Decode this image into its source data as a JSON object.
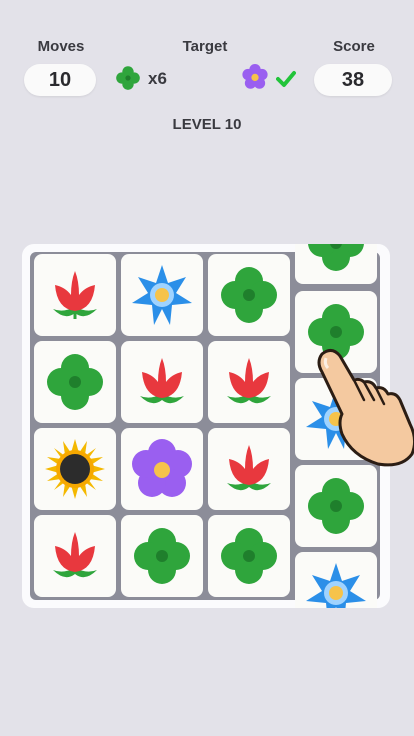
{
  "hud": {
    "moves_label": "Moves",
    "moves_value": "10",
    "target_label": "Target",
    "target_clover_count": "x6",
    "target_flower_done": true,
    "score_label": "Score",
    "score_value": "38"
  },
  "level_text": "LEVEL 10",
  "board": {
    "columns": [
      [
        "tulip",
        "clover",
        "sunflower",
        "tulip"
      ],
      [
        "blue-star",
        "tulip",
        "purple-flower",
        "clover"
      ],
      [
        "clover",
        "tulip",
        "tulip",
        "clover"
      ],
      [
        "clover",
        "clover",
        "blue-star",
        "clover",
        "blue-star"
      ]
    ],
    "dragging_column": 3
  },
  "colors": {
    "background": "#e3e2e9",
    "tulip": "#e8383e",
    "clover": "#2fa53c",
    "blue_star": "#2b8fe8",
    "purple_flower": "#9a5ff0",
    "sunflower": "#f4b800",
    "check": "#22c43a"
  }
}
